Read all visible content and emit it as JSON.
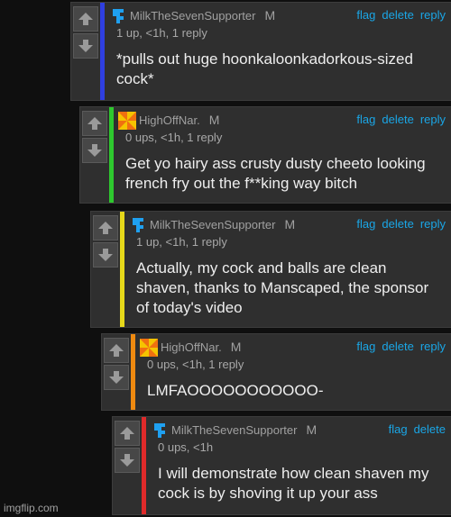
{
  "comments": [
    {
      "username": "MilkTheSevenSupporter",
      "badge": "M",
      "meta": "1 up, <1h, 1 reply",
      "body": "*pulls out huge hoonkaloonkadorkous-sized cock*",
      "actions": [
        "flag",
        "delete",
        "reply"
      ],
      "bar_color": "#2f3fe0",
      "avatar": "blue-pixel-avatar"
    },
    {
      "username": "HighOffNar.",
      "badge": "M",
      "meta": "0 ups, <1h, 1 reply",
      "body": "Get yo hairy ass crusty dusty cheeto looking french fry out the f**king way bitch",
      "actions": [
        "flag",
        "delete",
        "reply"
      ],
      "bar_color": "#2ec82e",
      "avatar": "orange-pinwheel-avatar"
    },
    {
      "username": "MilkTheSevenSupporter",
      "badge": "M",
      "meta": "1 up, <1h, 1 reply",
      "body": "Actually, my cock and balls are clean shaven, thanks to Manscaped, the sponsor of today's video",
      "actions": [
        "flag",
        "delete",
        "reply"
      ],
      "bar_color": "#e6d81a",
      "avatar": "blue-pixel-avatar"
    },
    {
      "username": "HighOffNar.",
      "badge": "M",
      "meta": "0 ups, <1h, 1 reply",
      "body": "LMFAOOOOOOOOOOO-",
      "actions": [
        "flag",
        "delete",
        "reply"
      ],
      "bar_color": "#ef8a10",
      "avatar": "orange-pinwheel-avatar"
    },
    {
      "username": "MilkTheSevenSupporter",
      "badge": "M",
      "meta": "0 ups, <1h",
      "body": "I will demonstrate how clean shaven my cock is by shoving it up your ass",
      "actions": [
        "flag",
        "delete"
      ],
      "bar_color": "#e02a2a",
      "avatar": "blue-pixel-avatar"
    }
  ],
  "watermark": "imgflip.com"
}
